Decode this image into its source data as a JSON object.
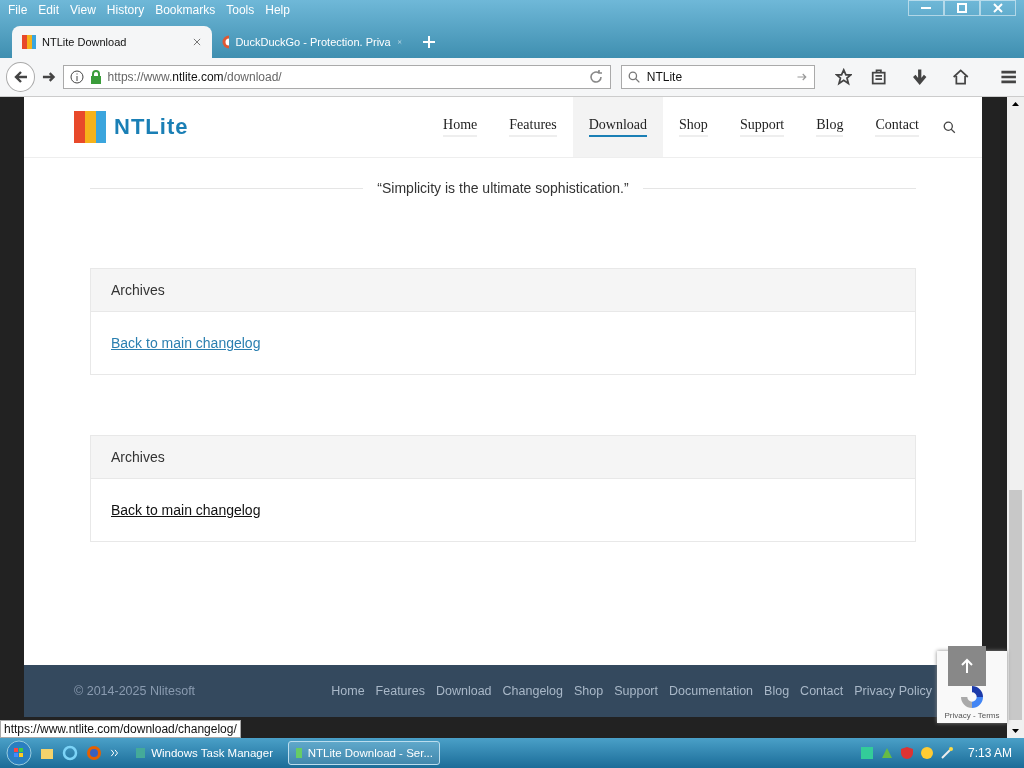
{
  "menu": [
    "File",
    "Edit",
    "View",
    "History",
    "Bookmarks",
    "Tools",
    "Help"
  ],
  "tabs": [
    {
      "title": "NTLite Download",
      "selected": true
    },
    {
      "title": "DuckDuckGo - Protection. Priva",
      "selected": false
    }
  ],
  "address": {
    "prefix": "https://www.",
    "domain": "ntlite.com",
    "path": "/download/"
  },
  "search": {
    "value": "NTLite"
  },
  "site": {
    "logo": "NTLite",
    "nav": [
      {
        "label": "Home",
        "selected": false
      },
      {
        "label": "Features",
        "selected": false
      },
      {
        "label": "Download",
        "selected": true
      },
      {
        "label": "Shop",
        "selected": false
      },
      {
        "label": "Support",
        "selected": false
      },
      {
        "label": "Blog",
        "selected": false
      },
      {
        "label": "Contact",
        "selected": false
      }
    ]
  },
  "quote": "“Simplicity is the ultimate sophistication.”",
  "archives": [
    {
      "title": "Archives",
      "link": "Back to main changelog",
      "hovered": true
    },
    {
      "title": "Archives",
      "link": "Back to main changelog",
      "hovered": false
    }
  ],
  "footer": {
    "copyright": "© 2014-2025 Nlitesoft",
    "links": [
      "Home",
      "Features",
      "Download",
      "Changelog",
      "Shop",
      "Support",
      "Documentation",
      "Blog",
      "Contact",
      "Privacy Policy"
    ]
  },
  "recaptcha": {
    "text": "Privacy - Terms"
  },
  "status_url": "https://www.ntlite.com/download/changelog/",
  "taskbar": {
    "items": [
      {
        "label": "Windows Task Manager",
        "selected": false
      },
      {
        "label": "NTLite Download - Ser...",
        "selected": true
      }
    ],
    "clock": "7:13 AM"
  }
}
